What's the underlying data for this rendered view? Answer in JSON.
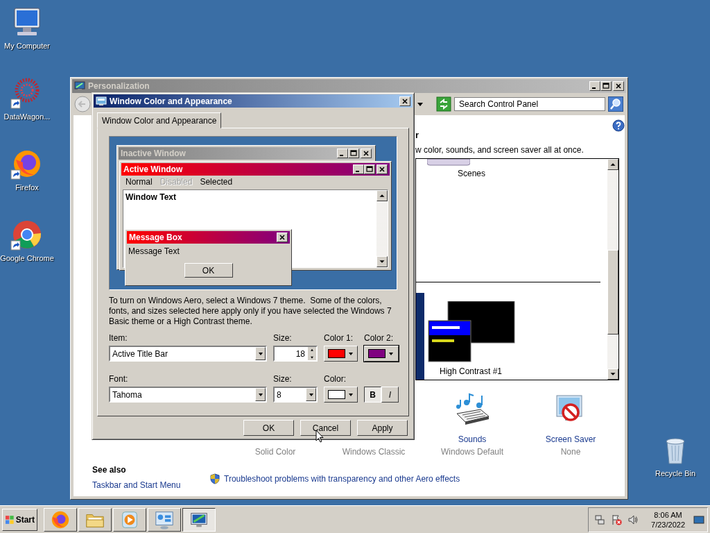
{
  "desktop_icons": [
    {
      "label": "My Computer",
      "kind": "computer",
      "shortcut": false
    },
    {
      "label": "DataWagon...",
      "kind": "ring",
      "shortcut": true
    },
    {
      "label": "Firefox",
      "kind": "firefox",
      "shortcut": true
    },
    {
      "label": "Google Chrome",
      "kind": "chrome",
      "shortcut": true
    }
  ],
  "recycle_bin": {
    "label": "Recycle Bin"
  },
  "personalization": {
    "title": "Personalization",
    "search": {
      "placeholder": "Search Control Panel"
    },
    "heading_fragment": "r",
    "description_fragment": "w color, sounds, and screen saver all at once.",
    "themes": [
      {
        "label": "Scenes",
        "kind": "scenes"
      },
      {
        "label": "High Contrast #1",
        "kind": "high-contrast"
      }
    ],
    "settings": [
      {
        "kind": "background",
        "value": "Solid Color"
      },
      {
        "kind": "color",
        "value": "Windows Classic"
      },
      {
        "kind": "sounds",
        "caption": "Sounds",
        "value": "Windows Default"
      },
      {
        "kind": "screensaver",
        "caption": "Screen Saver",
        "value": "None"
      }
    ],
    "see_also": {
      "heading": "See also",
      "links": [
        "Taskbar and Start Menu"
      ]
    },
    "troubleshoot_link": "Troubleshoot problems with transparency and other Aero effects"
  },
  "dialog": {
    "title": "Window Color and Appearance",
    "tabs": [
      {
        "label": "Window Color and Appearance",
        "selected": true
      }
    ],
    "preview": {
      "inactive_title": "Inactive Window",
      "active_title": "Active Window",
      "menu": [
        {
          "label": "Normal",
          "disabled": false
        },
        {
          "label": "Disabled",
          "disabled": true
        },
        {
          "label": "Selected",
          "disabled": false
        }
      ],
      "window_text": "Window Text",
      "message_title": "Message Box",
      "message_text": "Message Text",
      "message_button": "OK"
    },
    "description": "To turn on Windows Aero, select a Windows 7 theme.  Some of the colors, fonts, and sizes selected here apply only if you have selected the Windows 7 Basic theme or a High Contrast theme.",
    "item": {
      "label": "Item:",
      "value": "Active Title Bar"
    },
    "size": {
      "label": "Size:",
      "value": "18"
    },
    "color1": {
      "label": "Color 1:",
      "color": "#ff0000"
    },
    "color2": {
      "label": "Color 2:",
      "color": "#800080"
    },
    "font": {
      "label": "Font:",
      "value": "Tahoma"
    },
    "font_size": {
      "label": "Size:",
      "value": "8"
    },
    "font_color": {
      "label": "Color:",
      "color": "#ffffff"
    },
    "bold": {
      "label": "B",
      "selected": true
    },
    "italic": {
      "label": "I",
      "selected": false
    },
    "buttons": [
      "OK",
      "Cancel",
      "Apply"
    ]
  },
  "taskbar": {
    "start": "Start",
    "apps": [
      {
        "kind": "firefox",
        "selected": false
      },
      {
        "kind": "folder",
        "selected": false
      },
      {
        "kind": "media",
        "selected": false
      },
      {
        "kind": "control-panel",
        "selected": false
      },
      {
        "kind": "personalization",
        "selected": true
      }
    ],
    "clock": {
      "time": "8:06 AM",
      "date": "7/23/2022"
    }
  }
}
